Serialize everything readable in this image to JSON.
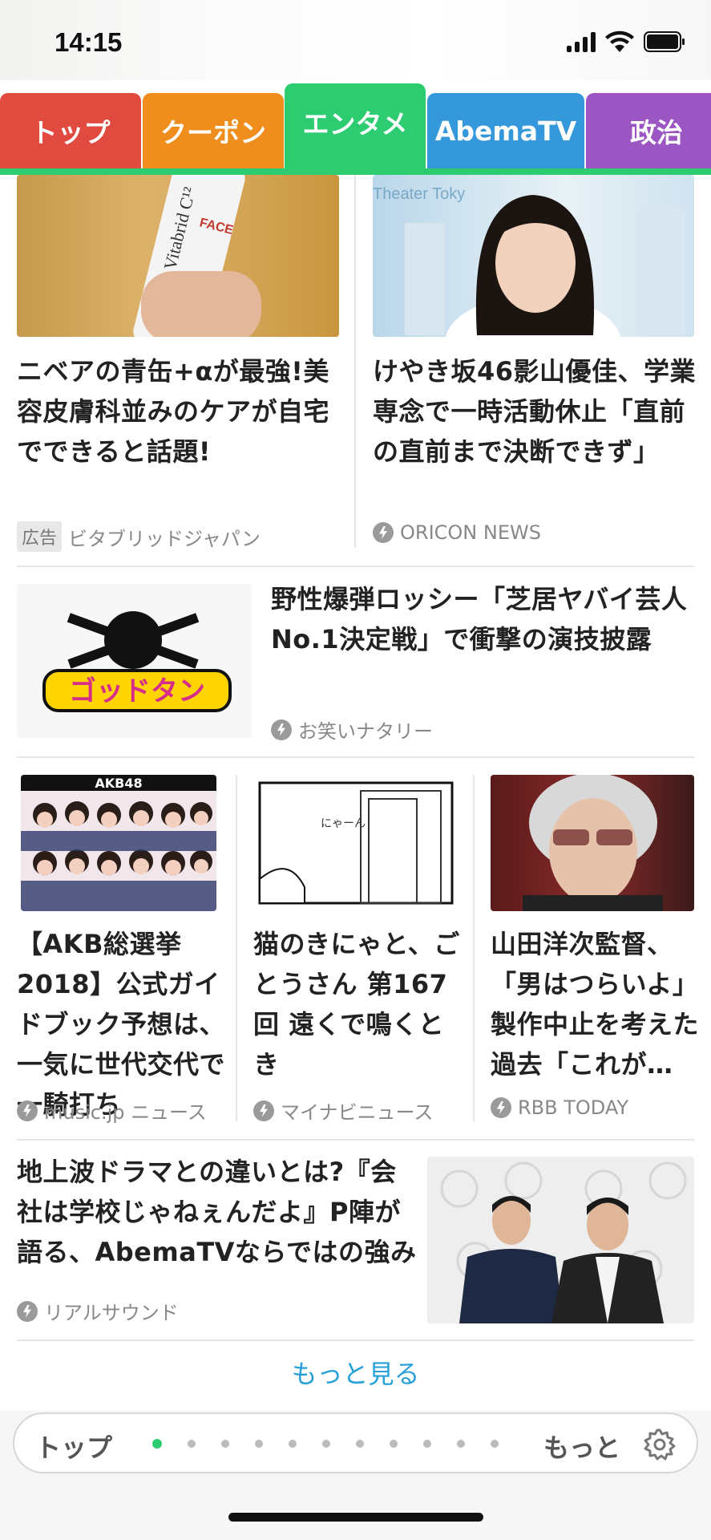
{
  "status": {
    "time": "14:15"
  },
  "tabs": [
    {
      "label": "トップ",
      "color": "#e04a3f"
    },
    {
      "label": "クーポン",
      "color": "#ef8e1c"
    },
    {
      "label": "エンタメ",
      "color": "#2ecc71"
    },
    {
      "label": "AbemaTV",
      "color": "#3598db"
    },
    {
      "label": "政治",
      "color": "#9b56c4"
    }
  ],
  "accent_color": "#2ecc71",
  "articles": {
    "a1": {
      "headline": "ニベアの青缶+αが最強!美容皮膚科並みのケアが自宅でできると話題!",
      "badge": "広告",
      "source": "ビタブリッドジャパン",
      "image_text": "FACE",
      "image_text2": "Vitabrid C¹²"
    },
    "a2": {
      "headline": "けやき坂46影山優佳、学業専念で一時活動休止「直前の直前まで決断できず」",
      "source": "ORICON NEWS",
      "image_text": "Theater Toky"
    },
    "a3": {
      "headline": "野性爆弾ロッシー「芝居ヤバイ芸人No.1決定戦」で衝撃の演技披露",
      "source": "お笑いナタリー",
      "image_text": "ゴッドタン"
    },
    "a4": {
      "headline": "【AKB総選挙2018】公式ガイドブック予想は、一気に世代交代で一騎打ち",
      "source": "music.jp ニュース",
      "image_text": "AKB48"
    },
    "a5": {
      "headline": "猫のきにゃと、ごとうさん 第167回 遠くで鳴くとき",
      "source": "マイナビニュース",
      "image_text": "にゃーん"
    },
    "a6": {
      "headline": "山田洋次監督、「男はつらいよ」製作中止を考えた過去「これが…",
      "source": "RBB TODAY"
    },
    "a7": {
      "headline": "地上波ドラマとの違いとは?『会社は学校じゃねぇんだよ』P陣が語る、AbemaTVならではの強み",
      "source": "リアルサウンド"
    }
  },
  "more_label": "もっと見る",
  "bottom": {
    "left_label": "トップ",
    "right_label": "もっと"
  }
}
